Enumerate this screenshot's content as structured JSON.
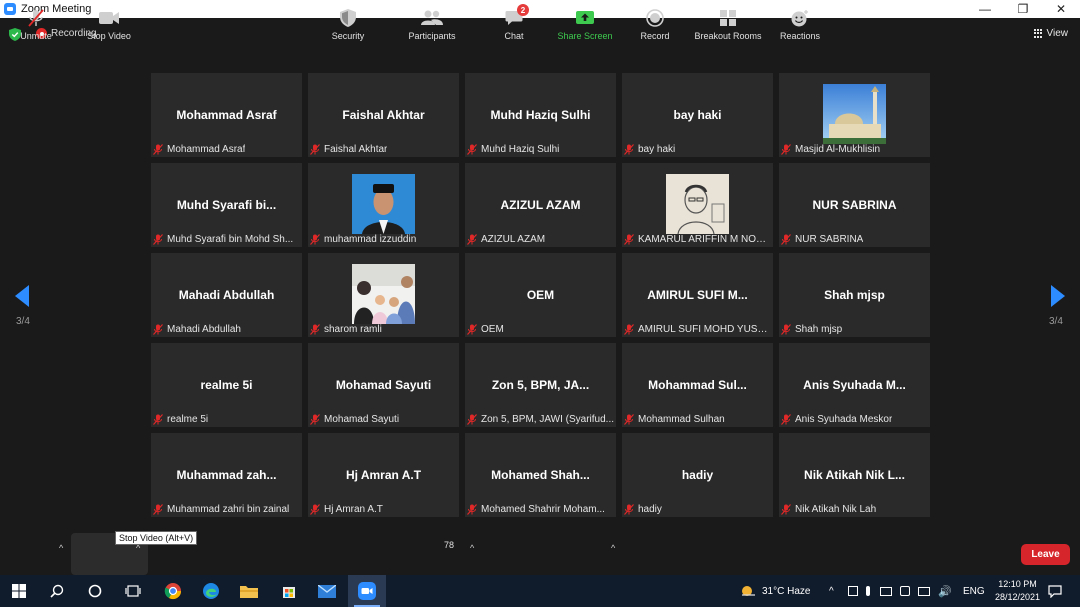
{
  "window": {
    "title": "Zoom Meeting",
    "minimize": "—",
    "restore": "❐",
    "close": "✕"
  },
  "topbar": {
    "recording_label": "Recording",
    "view_label": "View"
  },
  "gallery": {
    "page_indicator_left": "3/4",
    "page_indicator_right": "3/4",
    "tiles": [
      {
        "big": "Mohammad Asraf",
        "name": "Mohammad Asraf",
        "photo": ""
      },
      {
        "big": "Faishal Akhtar",
        "name": "Faishal Akhtar",
        "photo": ""
      },
      {
        "big": "Muhd Haziq Sulhi",
        "name": "Muhd Haziq Sulhi",
        "photo": ""
      },
      {
        "big": "bay haki",
        "name": "bay haki",
        "photo": ""
      },
      {
        "big": "",
        "name": "Masjid Al-Mukhlisin",
        "photo": "mosque"
      },
      {
        "big": "Muhd Syarafi bi...",
        "name": "Muhd Syarafi bin Mohd Sh...",
        "photo": ""
      },
      {
        "big": "",
        "name": "muhammad izzuddin",
        "photo": "portrait"
      },
      {
        "big": "AZIZUL AZAM",
        "name": "AZIZUL AZAM",
        "photo": ""
      },
      {
        "big": "",
        "name": "KAMARUL ARIFFIN M NOO...",
        "photo": "sketch"
      },
      {
        "big": "NUR SABRINA",
        "name": "NUR SABRINA",
        "photo": ""
      },
      {
        "big": "Mahadi Abdullah",
        "name": "Mahadi Abdullah",
        "photo": ""
      },
      {
        "big": "",
        "name": "sharom ramli",
        "photo": "family"
      },
      {
        "big": "OEM",
        "name": "OEM",
        "photo": ""
      },
      {
        "big": "AMIRUL SUFI M...",
        "name": "AMIRUL SUFI MOHD YUSO...",
        "photo": ""
      },
      {
        "big": "Shah mjsp",
        "name": "Shah mjsp",
        "photo": ""
      },
      {
        "big": "realme 5i",
        "name": "realme 5i",
        "photo": ""
      },
      {
        "big": "Mohamad Sayuti",
        "name": "Mohamad Sayuti",
        "photo": ""
      },
      {
        "big": "Zon 5, BPM, JA...",
        "name": "Zon 5, BPM, JAWI (Syarifud...",
        "photo": ""
      },
      {
        "big": "Mohammad  Sul...",
        "name": "Mohammad Sulhan",
        "photo": ""
      },
      {
        "big": "Anis Syuhada M...",
        "name": "Anis Syuhada Meskor",
        "photo": ""
      },
      {
        "big": "Muhammad  zah...",
        "name": "Muhammad zahri bin zainal",
        "photo": ""
      },
      {
        "big": "Hj Amran A.T",
        "name": "Hj Amran A.T",
        "photo": ""
      },
      {
        "big": "Mohamed  Shah...",
        "name": "Mohamed Shahrir Moham...",
        "photo": ""
      },
      {
        "big": "hadiy",
        "name": "hadiy",
        "photo": ""
      },
      {
        "big": "Nik Atikah Nik L...",
        "name": "Nik Atikah Nik Lah",
        "photo": ""
      }
    ]
  },
  "tooltip": "Stop Video (Alt+V)",
  "toolbar": {
    "unmute": "Unmute",
    "stop_video": "Stop Video",
    "security": "Security",
    "participants": "Participants",
    "participants_count": "78",
    "chat": "Chat",
    "chat_badge": "2",
    "share_screen": "Share Screen",
    "record": "Record",
    "breakout_rooms": "Breakout Rooms",
    "reactions": "Reactions",
    "leave": "Leave"
  },
  "taskbar": {
    "weather": "31°C  Haze",
    "language": "ENG",
    "time": "12:10 PM",
    "date": "28/12/2021"
  },
  "colors": {
    "accent_blue": "#2d8cff",
    "share_green": "#3ec94f",
    "leave_red": "#d7262b",
    "muted_red": "#e02828",
    "tile_bg": "#2a2a2a"
  }
}
